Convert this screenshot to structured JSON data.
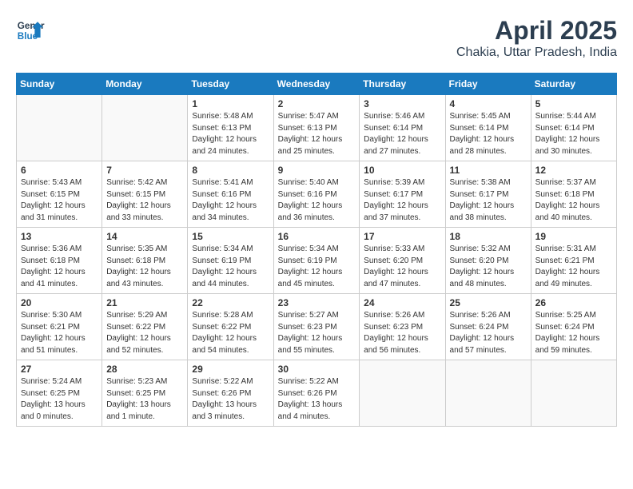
{
  "header": {
    "logo_line1": "General",
    "logo_line2": "Blue",
    "month_year": "April 2025",
    "location": "Chakia, Uttar Pradesh, India"
  },
  "weekdays": [
    "Sunday",
    "Monday",
    "Tuesday",
    "Wednesday",
    "Thursday",
    "Friday",
    "Saturday"
  ],
  "weeks": [
    [
      {
        "day": "",
        "info": ""
      },
      {
        "day": "",
        "info": ""
      },
      {
        "day": "1",
        "info": "Sunrise: 5:48 AM\nSunset: 6:13 PM\nDaylight: 12 hours\nand 24 minutes."
      },
      {
        "day": "2",
        "info": "Sunrise: 5:47 AM\nSunset: 6:13 PM\nDaylight: 12 hours\nand 25 minutes."
      },
      {
        "day": "3",
        "info": "Sunrise: 5:46 AM\nSunset: 6:14 PM\nDaylight: 12 hours\nand 27 minutes."
      },
      {
        "day": "4",
        "info": "Sunrise: 5:45 AM\nSunset: 6:14 PM\nDaylight: 12 hours\nand 28 minutes."
      },
      {
        "day": "5",
        "info": "Sunrise: 5:44 AM\nSunset: 6:14 PM\nDaylight: 12 hours\nand 30 minutes."
      }
    ],
    [
      {
        "day": "6",
        "info": "Sunrise: 5:43 AM\nSunset: 6:15 PM\nDaylight: 12 hours\nand 31 minutes."
      },
      {
        "day": "7",
        "info": "Sunrise: 5:42 AM\nSunset: 6:15 PM\nDaylight: 12 hours\nand 33 minutes."
      },
      {
        "day": "8",
        "info": "Sunrise: 5:41 AM\nSunset: 6:16 PM\nDaylight: 12 hours\nand 34 minutes."
      },
      {
        "day": "9",
        "info": "Sunrise: 5:40 AM\nSunset: 6:16 PM\nDaylight: 12 hours\nand 36 minutes."
      },
      {
        "day": "10",
        "info": "Sunrise: 5:39 AM\nSunset: 6:17 PM\nDaylight: 12 hours\nand 37 minutes."
      },
      {
        "day": "11",
        "info": "Sunrise: 5:38 AM\nSunset: 6:17 PM\nDaylight: 12 hours\nand 38 minutes."
      },
      {
        "day": "12",
        "info": "Sunrise: 5:37 AM\nSunset: 6:18 PM\nDaylight: 12 hours\nand 40 minutes."
      }
    ],
    [
      {
        "day": "13",
        "info": "Sunrise: 5:36 AM\nSunset: 6:18 PM\nDaylight: 12 hours\nand 41 minutes."
      },
      {
        "day": "14",
        "info": "Sunrise: 5:35 AM\nSunset: 6:18 PM\nDaylight: 12 hours\nand 43 minutes."
      },
      {
        "day": "15",
        "info": "Sunrise: 5:34 AM\nSunset: 6:19 PM\nDaylight: 12 hours\nand 44 minutes."
      },
      {
        "day": "16",
        "info": "Sunrise: 5:34 AM\nSunset: 6:19 PM\nDaylight: 12 hours\nand 45 minutes."
      },
      {
        "day": "17",
        "info": "Sunrise: 5:33 AM\nSunset: 6:20 PM\nDaylight: 12 hours\nand 47 minutes."
      },
      {
        "day": "18",
        "info": "Sunrise: 5:32 AM\nSunset: 6:20 PM\nDaylight: 12 hours\nand 48 minutes."
      },
      {
        "day": "19",
        "info": "Sunrise: 5:31 AM\nSunset: 6:21 PM\nDaylight: 12 hours\nand 49 minutes."
      }
    ],
    [
      {
        "day": "20",
        "info": "Sunrise: 5:30 AM\nSunset: 6:21 PM\nDaylight: 12 hours\nand 51 minutes."
      },
      {
        "day": "21",
        "info": "Sunrise: 5:29 AM\nSunset: 6:22 PM\nDaylight: 12 hours\nand 52 minutes."
      },
      {
        "day": "22",
        "info": "Sunrise: 5:28 AM\nSunset: 6:22 PM\nDaylight: 12 hours\nand 54 minutes."
      },
      {
        "day": "23",
        "info": "Sunrise: 5:27 AM\nSunset: 6:23 PM\nDaylight: 12 hours\nand 55 minutes."
      },
      {
        "day": "24",
        "info": "Sunrise: 5:26 AM\nSunset: 6:23 PM\nDaylight: 12 hours\nand 56 minutes."
      },
      {
        "day": "25",
        "info": "Sunrise: 5:26 AM\nSunset: 6:24 PM\nDaylight: 12 hours\nand 57 minutes."
      },
      {
        "day": "26",
        "info": "Sunrise: 5:25 AM\nSunset: 6:24 PM\nDaylight: 12 hours\nand 59 minutes."
      }
    ],
    [
      {
        "day": "27",
        "info": "Sunrise: 5:24 AM\nSunset: 6:25 PM\nDaylight: 13 hours\nand 0 minutes."
      },
      {
        "day": "28",
        "info": "Sunrise: 5:23 AM\nSunset: 6:25 PM\nDaylight: 13 hours\nand 1 minute."
      },
      {
        "day": "29",
        "info": "Sunrise: 5:22 AM\nSunset: 6:26 PM\nDaylight: 13 hours\nand 3 minutes."
      },
      {
        "day": "30",
        "info": "Sunrise: 5:22 AM\nSunset: 6:26 PM\nDaylight: 13 hours\nand 4 minutes."
      },
      {
        "day": "",
        "info": ""
      },
      {
        "day": "",
        "info": ""
      },
      {
        "day": "",
        "info": ""
      }
    ]
  ]
}
